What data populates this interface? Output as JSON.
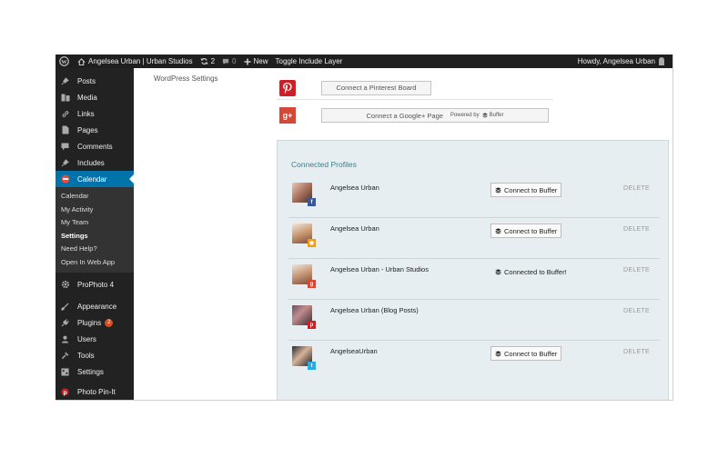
{
  "adminbar": {
    "site_name": "Angelsea Urban | Urban Studios",
    "updates_count": "2",
    "comments_count": "0",
    "new_label": "New",
    "toggle_label": "Toggle Include Layer",
    "howdy": "Howdy, Angelsea Urban"
  },
  "sidebar": {
    "items": [
      {
        "label": "Posts",
        "icon": "pin-icon"
      },
      {
        "label": "Media",
        "icon": "media-icon"
      },
      {
        "label": "Links",
        "icon": "link-icon"
      },
      {
        "label": "Pages",
        "icon": "page-icon"
      },
      {
        "label": "Comments",
        "icon": "comment-icon"
      },
      {
        "label": "Includes",
        "icon": "pin-icon"
      },
      {
        "label": "Calendar",
        "icon": "calendar-icon"
      }
    ],
    "submenu": [
      "Calendar",
      "My Activity",
      "My Team",
      "Settings",
      "Need Help?",
      "Open In Web App"
    ],
    "items2": [
      {
        "label": "ProPhoto 4",
        "icon": "gear-icon"
      },
      {
        "label": "Appearance",
        "icon": "brush-icon"
      },
      {
        "label": "Plugins",
        "icon": "plug-icon",
        "badge": "2"
      },
      {
        "label": "Users",
        "icon": "user-icon"
      },
      {
        "label": "Tools",
        "icon": "wrench-icon"
      },
      {
        "label": "Settings",
        "icon": "settings-icon"
      },
      {
        "label": "Photo Pin-It",
        "icon": "pinterest-icon"
      }
    ]
  },
  "main": {
    "settings_link": "WordPress Settings",
    "pinterest_button": "Connect a Pinterest Board",
    "gplus_button": "Connect a Google+ Page",
    "powered_by": "Powered by",
    "buffer_brand": "Buffer",
    "panel_title": "Connected Profiles",
    "profiles": [
      {
        "name": "Angelsea Urban",
        "network": "facebook",
        "action": "Connect to Buffer",
        "connected": false,
        "delete": "DELETE"
      },
      {
        "name": "Angelsea Urban",
        "network": "rss",
        "action": "Connect to Buffer",
        "connected": false,
        "delete": "DELETE"
      },
      {
        "name": "Angelsea Urban - Urban Studios",
        "network": "google-plus",
        "action": "Connected to Buffer!",
        "connected": true,
        "delete": "DELETE"
      },
      {
        "name": "Angelsea Urban (Blog Posts)",
        "network": "pinterest",
        "action": "",
        "connected": false,
        "delete": "DELETE"
      },
      {
        "name": "AngelseaUrban",
        "network": "twitter",
        "action": "Connect to Buffer",
        "connected": false,
        "delete": "DELETE"
      }
    ]
  },
  "colors": {
    "admin_bar": "#1f1f1f",
    "sidebar": "#222222",
    "active": "#0073aa",
    "panel": "#e6eef1",
    "title": "#3c7f8a",
    "pinterest": "#cb2027",
    "gplus": "#d34836",
    "facebook": "#3b5998",
    "rss": "#f39c12",
    "twitter": "#2ba9e1"
  }
}
